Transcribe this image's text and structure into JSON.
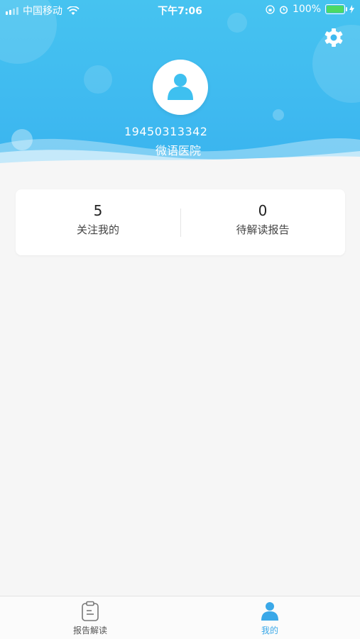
{
  "status_bar": {
    "carrier": "中国移动",
    "time": "下午7:06",
    "battery": "100%"
  },
  "profile": {
    "phone": "19450313342",
    "hospital": "微语医院"
  },
  "stats": [
    {
      "value": "5",
      "label": "关注我的"
    },
    {
      "value": "0",
      "label": "待解读报告"
    }
  ],
  "tabbar": {
    "items": [
      {
        "label": "报告解读",
        "active": false
      },
      {
        "label": "我的",
        "active": true
      }
    ]
  },
  "colors": {
    "accent": "#3fbaf0",
    "tab_active": "#3aa8e8",
    "tab_inactive": "#666666"
  }
}
